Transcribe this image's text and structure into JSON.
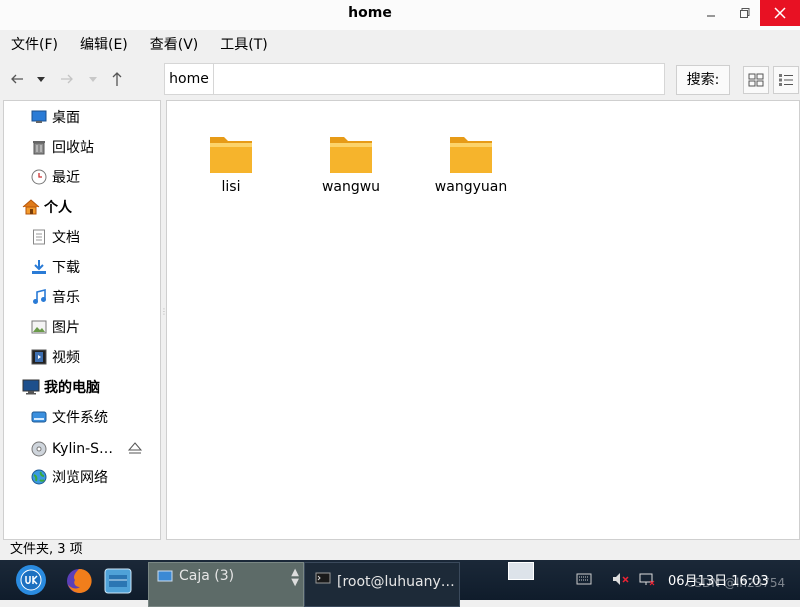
{
  "window": {
    "title": "home",
    "buttons": {
      "minimize": "–",
      "maximize": "❐",
      "close": "✕"
    }
  },
  "menu": [
    "文件(F)",
    "编辑(E)",
    "查看(V)",
    "工具(T)"
  ],
  "toolbar": {
    "back_icon": "back-arrow",
    "forward_icon": "forward-arrow",
    "up_icon": "up-arrow",
    "path_crumb": "home",
    "path_entry": "",
    "search_label": "搜索:"
  },
  "sidebar": {
    "items": [
      {
        "label": "桌面",
        "icon": "desktop-icon"
      },
      {
        "label": "回收站",
        "icon": "trash-icon"
      },
      {
        "label": "最近",
        "icon": "clock-icon"
      },
      {
        "label": "个人",
        "icon": "home-icon",
        "heading": true
      },
      {
        "label": "文档",
        "icon": "document-icon"
      },
      {
        "label": "下载",
        "icon": "download-icon"
      },
      {
        "label": "音乐",
        "icon": "music-icon"
      },
      {
        "label": "图片",
        "icon": "picture-icon"
      },
      {
        "label": "视频",
        "icon": "video-icon"
      },
      {
        "label": "我的电脑",
        "icon": "computer-icon",
        "heading": true
      },
      {
        "label": "文件系统",
        "icon": "drive-icon"
      },
      {
        "label": "Kylin-S…",
        "icon": "disc-icon"
      },
      {
        "label": "浏览网络",
        "icon": "network-icon"
      }
    ]
  },
  "files": [
    "lisi",
    "wangwu",
    "wangyuan"
  ],
  "status": "文件夹, 3 项",
  "taskbar": {
    "windows": [
      "Caja (3)",
      "[root@luhuany…"
    ],
    "time": "06月13日 16:03",
    "watermark": "CSDN @lh23754"
  },
  "colors": {
    "folder": "#f6b42c",
    "close_button": "#e81123",
    "taskbar": "#15222f"
  }
}
